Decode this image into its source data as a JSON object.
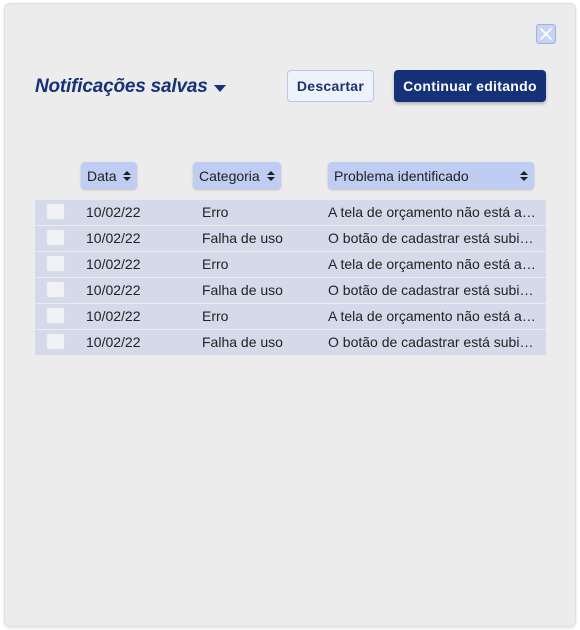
{
  "header": {
    "title": "Notificações salvas",
    "discard_label": "Descartar",
    "continue_label": "Continuar editando"
  },
  "table": {
    "columns": [
      "Data",
      "Categoria",
      "Problema identificado"
    ],
    "rows": [
      {
        "date": "10/02/22",
        "category": "Erro",
        "problem": "A tela de orçamento não está atualizando"
      },
      {
        "date": "10/02/22",
        "category": "Falha de uso",
        "problem": "O botão de cadastrar está subindo"
      },
      {
        "date": "10/02/22",
        "category": "Erro",
        "problem": "A tela de orçamento não está atualizando"
      },
      {
        "date": "10/02/22",
        "category": "Falha de uso",
        "problem": "O botão de cadastrar está subindo"
      },
      {
        "date": "10/02/22",
        "category": "Erro",
        "problem": "A tela de orçamento não está atualizando"
      },
      {
        "date": "10/02/22",
        "category": "Falha de uso",
        "problem": "O botão de cadastrar está subindo"
      }
    ]
  },
  "icons": {
    "close": "close-icon",
    "title_dropdown": "caret-down-icon",
    "sort": "sort-icon"
  },
  "colors": {
    "primary": "#153278",
    "header_bg": "#bfcdf3",
    "row_bg": "#d4dae9",
    "panel_bg": "#ececec"
  }
}
